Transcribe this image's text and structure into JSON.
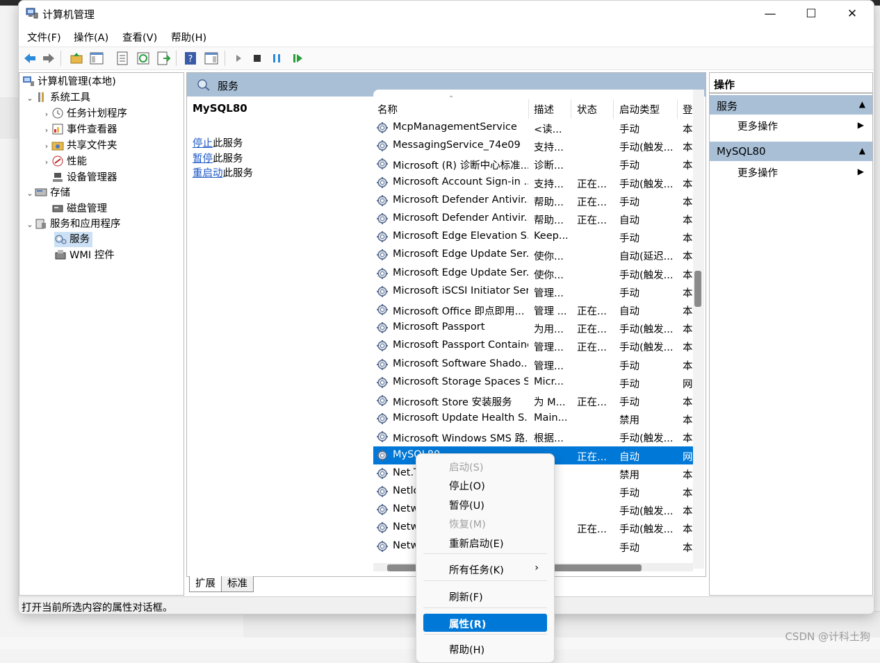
{
  "window": {
    "title": "计算机管理",
    "controls": {
      "minimize": "—",
      "maximize": "☐",
      "close": "✕"
    }
  },
  "menu": [
    "文件(F)",
    "操作(A)",
    "查看(V)",
    "帮助(H)"
  ],
  "tree": {
    "root": "计算机管理(本地)",
    "items": [
      {
        "label": "系统工具",
        "icon": "tools-icon"
      },
      {
        "label": "任务计划程序",
        "icon": "clock-icon"
      },
      {
        "label": "事件查看器",
        "icon": "event-viewer-icon"
      },
      {
        "label": "共享文件夹",
        "icon": "shared-folder-icon"
      },
      {
        "label": "性能",
        "icon": "performance-icon"
      },
      {
        "label": "设备管理器",
        "icon": "device-manager-icon"
      },
      {
        "label": "存储",
        "icon": "storage-icon"
      },
      {
        "label": "磁盘管理",
        "icon": "disk-icon"
      },
      {
        "label": "服务和应用程序",
        "icon": "services-apps-icon"
      },
      {
        "label": "服务",
        "icon": "services-icon"
      },
      {
        "label": "WMI 控件",
        "icon": "wmi-icon"
      }
    ]
  },
  "center": {
    "header": "服务",
    "selected_service": "MySQL80",
    "actions": [
      {
        "link": "停止",
        "text": "此服务"
      },
      {
        "link": "暂停",
        "text": "此服务"
      },
      {
        "link": "重启动",
        "text": "此服务"
      }
    ],
    "columns": [
      "名称",
      "描述",
      "状态",
      "启动类型",
      "登"
    ],
    "rows": [
      [
        "McpManagementService",
        "<读...",
        "",
        "手动",
        "本"
      ],
      [
        "MessagingService_74e09",
        "支持...",
        "",
        "手动(触发...",
        "本"
      ],
      [
        "Microsoft (R) 诊断中心标准...",
        "诊断...",
        "",
        "手动",
        "本"
      ],
      [
        "Microsoft Account Sign-in ...",
        "支持...",
        "正在...",
        "手动(触发...",
        "本"
      ],
      [
        "Microsoft Defender Antivir...",
        "帮助...",
        "正在...",
        "手动",
        "本"
      ],
      [
        "Microsoft Defender Antivir...",
        "帮助...",
        "正在...",
        "自动",
        "本"
      ],
      [
        "Microsoft Edge Elevation S...",
        "Keep...",
        "",
        "手动",
        "本"
      ],
      [
        "Microsoft Edge Update Ser...",
        "使你...",
        "",
        "自动(延迟...",
        "本"
      ],
      [
        "Microsoft Edge Update Ser...",
        "使你...",
        "",
        "手动(触发...",
        "本"
      ],
      [
        "Microsoft iSCSI Initiator Ser...",
        "管理...",
        "",
        "手动",
        "本"
      ],
      [
        "Microsoft Office 即点即用...",
        "管理 ...",
        "正在...",
        "自动",
        "本"
      ],
      [
        "Microsoft Passport",
        "为用...",
        "正在...",
        "手动(触发...",
        "本"
      ],
      [
        "Microsoft Passport Container",
        "管理...",
        "正在...",
        "手动(触发...",
        "本"
      ],
      [
        "Microsoft Software Shado...",
        "管理...",
        "",
        "手动",
        "本"
      ],
      [
        "Microsoft Storage Spaces S...",
        "Micr...",
        "",
        "手动",
        "网"
      ],
      [
        "Microsoft Store 安装服务",
        "为 M...",
        "正在...",
        "手动",
        "本"
      ],
      [
        "Microsoft Update Health S...",
        "Main...",
        "",
        "禁用",
        "本"
      ],
      [
        "Microsoft Windows SMS 路...",
        "根据...",
        "",
        "手动(触发...",
        "本"
      ],
      [
        "MySQL80",
        "",
        "正在...",
        "自动",
        "网"
      ],
      [
        "Net.T",
        "...",
        "",
        "禁用",
        "本"
      ],
      [
        "Netlo",
        "...",
        "",
        "手动",
        "本"
      ],
      [
        "Netw",
        "...",
        "",
        "手动(触发...",
        "本"
      ],
      [
        "Netw",
        "...",
        "正在...",
        "手动(触发...",
        "本"
      ],
      [
        "Netw",
        "“...",
        "",
        "手动",
        "本"
      ]
    ],
    "tabs": [
      "扩展",
      "标准"
    ]
  },
  "actions_panel": {
    "title": "操作",
    "groups": [
      {
        "name": "服务",
        "more": "更多操作"
      },
      {
        "name": "MySQL80",
        "more": "更多操作"
      }
    ]
  },
  "status": "打开当前所选内容的属性对话框。",
  "context_menu": {
    "items": [
      {
        "label": "启动(S)",
        "disabled": true
      },
      {
        "label": "停止(O)",
        "disabled": false
      },
      {
        "label": "暂停(U)",
        "disabled": false
      },
      {
        "label": "恢复(M)",
        "disabled": true
      },
      {
        "label": "重新启动(E)",
        "disabled": false
      },
      {
        "label": "所有任务(K)",
        "disabled": false,
        "submenu": "›"
      },
      {
        "label": "刷新(F)",
        "disabled": false
      },
      {
        "label": "属性(R)",
        "disabled": false,
        "highlighted": true
      },
      {
        "label": "帮助(H)",
        "disabled": false
      }
    ]
  },
  "watermark": "CSDN @计科土狗",
  "colors": {
    "selection": "#0078d7",
    "pane_header": "#a8bfd6"
  }
}
